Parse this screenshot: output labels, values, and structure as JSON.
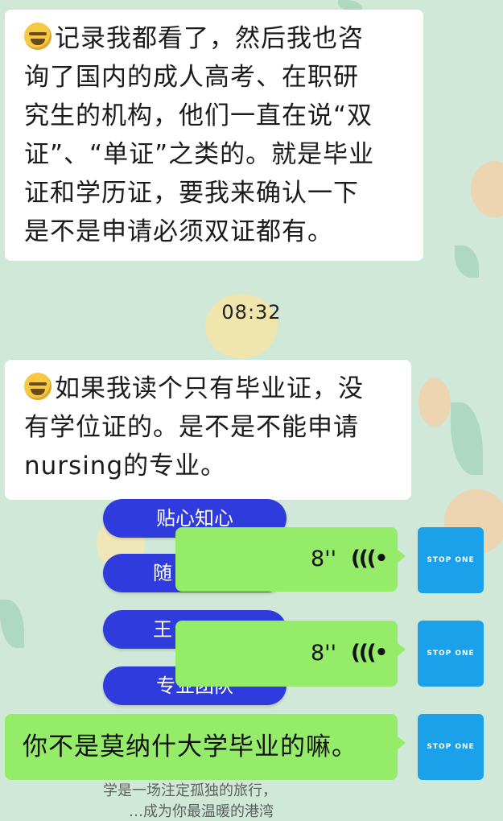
{
  "messages": {
    "m1_lines": [
      "记录我都看了，然后我也咨",
      "询了国内的成人高考、在职研",
      "究生的机构，他们一直在说“双",
      "证”、“单证”之类的。就是毕业",
      "证和学历证，要我来确认一下",
      "是不是申请必须双证都有。"
    ],
    "timestamp": "08:32",
    "m2_lines": [
      "如果我读个只有毕业证，没",
      "有学位证的。是不是不能申请",
      "nursing的专业。"
    ],
    "voice1_duration": "8''",
    "voice2_duration": "8''",
    "m3": "你不是莫纳什大学毕业的嘛。"
  },
  "ad_buttons": [
    "贴心知心",
    "随",
    "王",
    "专业团队"
  ],
  "avatar_label": "STOP ONE",
  "ghost_lines": [
    "学是一场注定孤独的旅行，",
    "…成为你最温暖的港湾"
  ],
  "colors": {
    "sent_bubble": "#95ec69",
    "received_bubble": "#ffffff",
    "background": "#cfe8d8",
    "avatar": "#1aa1ea",
    "ad_pill": "#2f3bdc"
  },
  "icons": {
    "emoji": "crying-laughing-emoji",
    "voice": "voice-wave-icon"
  }
}
